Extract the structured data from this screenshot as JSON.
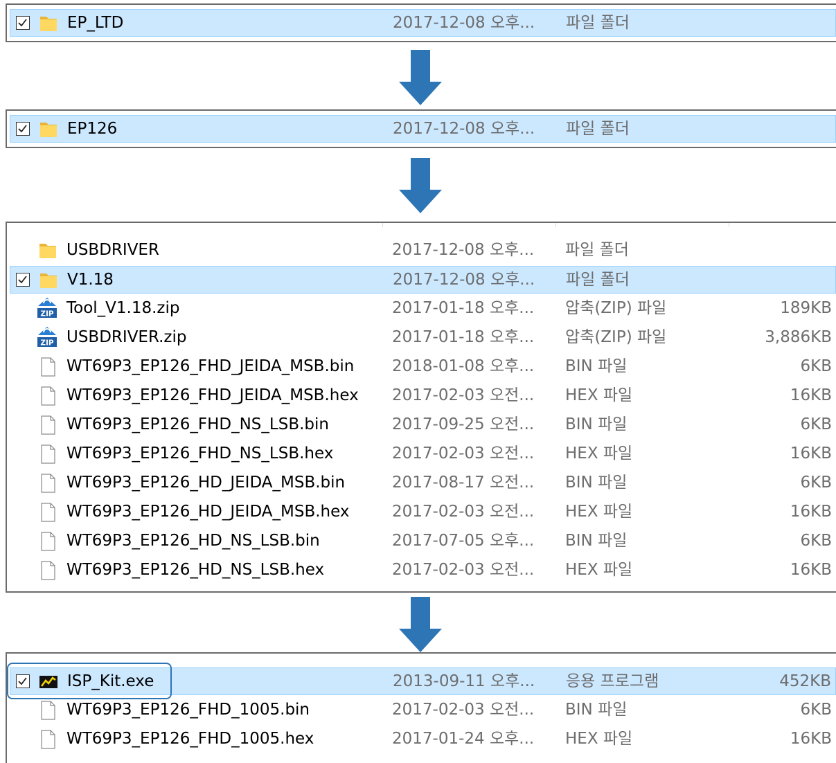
{
  "panel1": {
    "rows": [
      {
        "name": "EP_LTD",
        "date": "2017-12-08 오후...",
        "type": "파일 폴더",
        "size": "",
        "icon": "folder-icon",
        "selected": true,
        "checked": true
      }
    ]
  },
  "panel2": {
    "rows": [
      {
        "name": "EP126",
        "date": "2017-12-08 오후...",
        "type": "파일 폴더",
        "size": "",
        "icon": "folder-icon",
        "selected": true,
        "checked": true
      }
    ]
  },
  "panel3": {
    "rows": [
      {
        "name": "USBDRIVER",
        "date": "2017-12-08 오후...",
        "type": "파일 폴더",
        "size": "",
        "icon": "folder-icon",
        "selected": false,
        "checked": false
      },
      {
        "name": "V1.18",
        "date": "2017-12-08 오후...",
        "type": "파일 폴더",
        "size": "",
        "icon": "folder-icon",
        "selected": true,
        "checked": true
      },
      {
        "name": "Tool_V1.18.zip",
        "date": "2017-01-18 오후...",
        "type": "압축(ZIP) 파일",
        "size": "189KB",
        "icon": "zip-icon",
        "selected": false,
        "checked": false
      },
      {
        "name": "USBDRIVER.zip",
        "date": "2017-01-18 오후...",
        "type": "압축(ZIP) 파일",
        "size": "3,886KB",
        "icon": "zip-icon",
        "selected": false,
        "checked": false
      },
      {
        "name": "WT69P3_EP126_FHD_JEIDA_MSB.bin",
        "date": "2018-01-08 오후...",
        "type": "BIN 파일",
        "size": "6KB",
        "icon": "file-icon",
        "selected": false,
        "checked": false
      },
      {
        "name": "WT69P3_EP126_FHD_JEIDA_MSB.hex",
        "date": "2017-02-03 오전...",
        "type": "HEX 파일",
        "size": "16KB",
        "icon": "file-icon",
        "selected": false,
        "checked": false
      },
      {
        "name": "WT69P3_EP126_FHD_NS_LSB.bin",
        "date": "2017-09-25 오전...",
        "type": "BIN 파일",
        "size": "6KB",
        "icon": "file-icon",
        "selected": false,
        "checked": false
      },
      {
        "name": "WT69P3_EP126_FHD_NS_LSB.hex",
        "date": "2017-02-03 오전...",
        "type": "HEX 파일",
        "size": "16KB",
        "icon": "file-icon",
        "selected": false,
        "checked": false
      },
      {
        "name": "WT69P3_EP126_HD_JEIDA_MSB.bin",
        "date": "2017-08-17 오전...",
        "type": "BIN 파일",
        "size": "6KB",
        "icon": "file-icon",
        "selected": false,
        "checked": false
      },
      {
        "name": "WT69P3_EP126_HD_JEIDA_MSB.hex",
        "date": "2017-02-03 오전...",
        "type": "HEX 파일",
        "size": "16KB",
        "icon": "file-icon",
        "selected": false,
        "checked": false
      },
      {
        "name": "WT69P3_EP126_HD_NS_LSB.bin",
        "date": "2017-07-05 오후...",
        "type": "BIN 파일",
        "size": "6KB",
        "icon": "file-icon",
        "selected": false,
        "checked": false
      },
      {
        "name": "WT69P3_EP126_HD_NS_LSB.hex",
        "date": "2017-02-03 오전...",
        "type": "HEX 파일",
        "size": "16KB",
        "icon": "file-icon",
        "selected": false,
        "checked": false
      }
    ]
  },
  "panel4": {
    "rows": [
      {
        "name": "ISP_Kit.exe",
        "date": "2013-09-11 오후...",
        "type": "응용 프로그램",
        "size": "452KB",
        "icon": "exe-icon",
        "selected": true,
        "checked": true
      },
      {
        "name": "WT69P3_EP126_FHD_1005.bin",
        "date": "2017-02-03 오전...",
        "type": "BIN 파일",
        "size": "6KB",
        "icon": "file-icon",
        "selected": false,
        "checked": false
      },
      {
        "name": "WT69P3_EP126_FHD_1005.hex",
        "date": "2017-01-24 오후...",
        "type": "HEX 파일",
        "size": "16KB",
        "icon": "file-icon",
        "selected": false,
        "checked": false
      }
    ]
  },
  "colors": {
    "selection_bg": "#cce8ff",
    "selection_border": "#99d1ff",
    "arrow": "#2e75b6",
    "highlight_box": "#2e75b6",
    "muted_text": "#6d6d6d"
  }
}
